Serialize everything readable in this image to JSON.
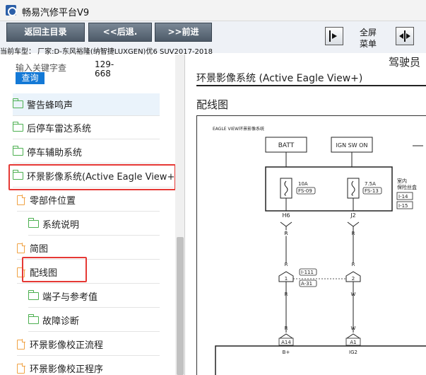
{
  "app": {
    "title": "畅易汽修平台V9"
  },
  "toolbar": {
    "home_label": "返回主目录",
    "back_label": "<<后退.",
    "forward_label": ">>前进",
    "fullscreen_label_1": "全屏",
    "fullscreen_label_2": "菜单"
  },
  "current_model": "当前车型： 厂家:D-东风裕隆(纳智捷LUXGEN)优6 SUV2017-2018",
  "search": {
    "placeholder": "输入关键字查",
    "range_1": "129-",
    "range_2": "668",
    "query_label": "查询"
  },
  "tree": {
    "items": [
      {
        "label": "警告蜂鸣声",
        "icon": "folder-icon"
      },
      {
        "label": "后停车雷达系统",
        "icon": "folder-icon"
      },
      {
        "label": "停车辅助系统",
        "icon": "folder-icon"
      },
      {
        "label": "环景影像系统(Active Eagle View+)",
        "icon": "folder-open-icon"
      },
      {
        "label": "零部件位置",
        "icon": "document-icon"
      },
      {
        "label": "系统说明",
        "icon": "folder-icon"
      },
      {
        "label": "简图",
        "icon": "document-icon"
      },
      {
        "label": "配线图",
        "icon": "document-icon"
      },
      {
        "label": "端子与参考值",
        "icon": "folder-icon"
      },
      {
        "label": "故障诊断",
        "icon": "folder-icon"
      },
      {
        "label": "环景影像校正流程",
        "icon": "document-icon"
      },
      {
        "label": "环景影像校正程序",
        "icon": "document-icon"
      }
    ]
  },
  "document": {
    "corner_text": "驾驶员",
    "title": "环景影像系统 (Active Eagle View+)",
    "subtitle": "配线图"
  },
  "diagram": {
    "header": "EAGLE VIEW环景影像系统",
    "batt": "BATT",
    "ign": "IGN SW ON",
    "fuse1_amp": "10A",
    "fuse1_id": "FS-09",
    "fuse2_amp": "7.5A",
    "fuse2_id": "FS-13",
    "box_label_1": "室内",
    "box_label_2": "保险丝盒",
    "conn_1": "I-14",
    "conn_2": "I-15",
    "pin_h6": "H6",
    "pin_j2": "J2",
    "wire_r": "R",
    "wire_w": "W",
    "splice_1": "1",
    "splice_2": "2",
    "conn_i111": "I-111",
    "conn_a31": "A-31",
    "pin_a14": "A14",
    "pin_a1": "A1",
    "sig_bplus": "B+",
    "sig_ig2": "IG2"
  },
  "colors": {
    "accent": "#1479d6",
    "highlight_box": "#e53935",
    "folder": "#4caf50",
    "document": "#f0a244"
  }
}
